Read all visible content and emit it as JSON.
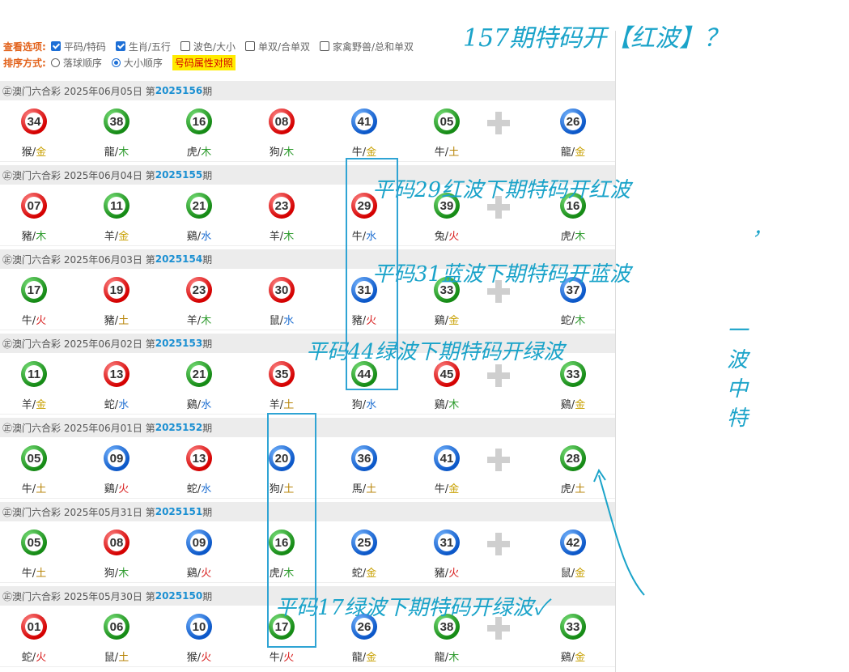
{
  "options": {
    "view_label": "查看选项:",
    "view_items": [
      {
        "label": "平码/特码",
        "checked": true
      },
      {
        "label": "生肖/五行",
        "checked": true
      },
      {
        "label": "波色/大小",
        "checked": false
      },
      {
        "label": "单双/合单双",
        "checked": false
      },
      {
        "label": "家禽野兽/总和单双",
        "checked": false
      }
    ],
    "sort_label": "排序方式:",
    "sort_items": [
      {
        "label": "落球顺序",
        "selected": false
      },
      {
        "label": "大小顺序",
        "selected": true
      }
    ],
    "attr_button": "号码属性对照"
  },
  "draws": [
    {
      "prefix": "㊣澳门六合彩 2025年06月05日 第",
      "period": "2025156",
      "suffix": "期",
      "balls": [
        {
          "n": "34",
          "c": "red",
          "z": "猴",
          "e": "金"
        },
        {
          "n": "38",
          "c": "green",
          "z": "龍",
          "e": "木"
        },
        {
          "n": "16",
          "c": "green",
          "z": "虎",
          "e": "木"
        },
        {
          "n": "08",
          "c": "red",
          "z": "狗",
          "e": "木"
        },
        {
          "n": "41",
          "c": "blue",
          "z": "牛",
          "e": "金"
        },
        {
          "n": "05",
          "c": "green",
          "z": "牛",
          "e": "土"
        }
      ],
      "special": {
        "n": "26",
        "c": "blue",
        "z": "龍",
        "e": "金"
      }
    },
    {
      "prefix": "㊣澳门六合彩 2025年06月04日 第",
      "period": "2025155",
      "suffix": "期",
      "balls": [
        {
          "n": "07",
          "c": "red",
          "z": "豬",
          "e": "木"
        },
        {
          "n": "11",
          "c": "green",
          "z": "羊",
          "e": "金"
        },
        {
          "n": "21",
          "c": "green",
          "z": "鷄",
          "e": "水"
        },
        {
          "n": "23",
          "c": "red",
          "z": "羊",
          "e": "木"
        },
        {
          "n": "29",
          "c": "red",
          "z": "牛",
          "e": "水"
        },
        {
          "n": "39",
          "c": "green",
          "z": "兔",
          "e": "火"
        }
      ],
      "special": {
        "n": "16",
        "c": "green",
        "z": "虎",
        "e": "木"
      }
    },
    {
      "prefix": "㊣澳门六合彩 2025年06月03日 第",
      "period": "2025154",
      "suffix": "期",
      "balls": [
        {
          "n": "17",
          "c": "green",
          "z": "牛",
          "e": "火"
        },
        {
          "n": "19",
          "c": "red",
          "z": "豬",
          "e": "土"
        },
        {
          "n": "23",
          "c": "red",
          "z": "羊",
          "e": "木"
        },
        {
          "n": "30",
          "c": "red",
          "z": "鼠",
          "e": "水"
        },
        {
          "n": "31",
          "c": "blue",
          "z": "豬",
          "e": "火"
        },
        {
          "n": "33",
          "c": "green",
          "z": "鷄",
          "e": "金"
        }
      ],
      "special": {
        "n": "37",
        "c": "blue",
        "z": "蛇",
        "e": "木"
      }
    },
    {
      "prefix": "㊣澳门六合彩 2025年06月02日 第",
      "period": "2025153",
      "suffix": "期",
      "balls": [
        {
          "n": "11",
          "c": "green",
          "z": "羊",
          "e": "金"
        },
        {
          "n": "13",
          "c": "red",
          "z": "蛇",
          "e": "水"
        },
        {
          "n": "21",
          "c": "green",
          "z": "鷄",
          "e": "水"
        },
        {
          "n": "35",
          "c": "red",
          "z": "羊",
          "e": "土"
        },
        {
          "n": "44",
          "c": "green",
          "z": "狗",
          "e": "水"
        },
        {
          "n": "45",
          "c": "red",
          "z": "鷄",
          "e": "木"
        }
      ],
      "special": {
        "n": "33",
        "c": "green",
        "z": "鷄",
        "e": "金"
      }
    },
    {
      "prefix": "㊣澳门六合彩 2025年06月01日 第",
      "period": "2025152",
      "suffix": "期",
      "balls": [
        {
          "n": "05",
          "c": "green",
          "z": "牛",
          "e": "土"
        },
        {
          "n": "09",
          "c": "blue",
          "z": "鷄",
          "e": "火"
        },
        {
          "n": "13",
          "c": "red",
          "z": "蛇",
          "e": "水"
        },
        {
          "n": "20",
          "c": "blue",
          "z": "狗",
          "e": "土"
        },
        {
          "n": "36",
          "c": "blue",
          "z": "馬",
          "e": "土"
        },
        {
          "n": "41",
          "c": "blue",
          "z": "牛",
          "e": "金"
        }
      ],
      "special": {
        "n": "28",
        "c": "green",
        "z": "虎",
        "e": "土"
      }
    },
    {
      "prefix": "㊣澳门六合彩 2025年05月31日 第",
      "period": "2025151",
      "suffix": "期",
      "balls": [
        {
          "n": "05",
          "c": "green",
          "z": "牛",
          "e": "土"
        },
        {
          "n": "08",
          "c": "red",
          "z": "狗",
          "e": "木"
        },
        {
          "n": "09",
          "c": "blue",
          "z": "鷄",
          "e": "火"
        },
        {
          "n": "16",
          "c": "green",
          "z": "虎",
          "e": "木"
        },
        {
          "n": "25",
          "c": "blue",
          "z": "蛇",
          "e": "金"
        },
        {
          "n": "31",
          "c": "blue",
          "z": "豬",
          "e": "火"
        }
      ],
      "special": {
        "n": "42",
        "c": "blue",
        "z": "鼠",
        "e": "金"
      }
    },
    {
      "prefix": "㊣澳门六合彩 2025年05月30日 第",
      "period": "2025150",
      "suffix": "期",
      "balls": [
        {
          "n": "01",
          "c": "red",
          "z": "蛇",
          "e": "火"
        },
        {
          "n": "06",
          "c": "green",
          "z": "鼠",
          "e": "土"
        },
        {
          "n": "10",
          "c": "blue",
          "z": "猴",
          "e": "火"
        },
        {
          "n": "17",
          "c": "green",
          "z": "牛",
          "e": "火"
        },
        {
          "n": "26",
          "c": "blue",
          "z": "龍",
          "e": "金"
        },
        {
          "n": "38",
          "c": "green",
          "z": "龍",
          "e": "木"
        }
      ],
      "special": {
        "n": "33",
        "c": "green",
        "z": "鷄",
        "e": "金"
      }
    }
  ],
  "annotations": {
    "title": "157期特码开【红波】？",
    "note1": "平码29红波下期特码开红波",
    "comma": "，",
    "note2": "平码31蓝波下期特码开蓝波",
    "note3": "平码44绿波下期特码开绿波",
    "note4": "平码17绿波下期特码开绿波✓",
    "side": [
      "一",
      "波",
      "中",
      "特"
    ]
  },
  "colors": {
    "red": "#d40000",
    "blue": "#0b57c8",
    "green": "#158a15",
    "handwriting": "#1aa3c9"
  }
}
